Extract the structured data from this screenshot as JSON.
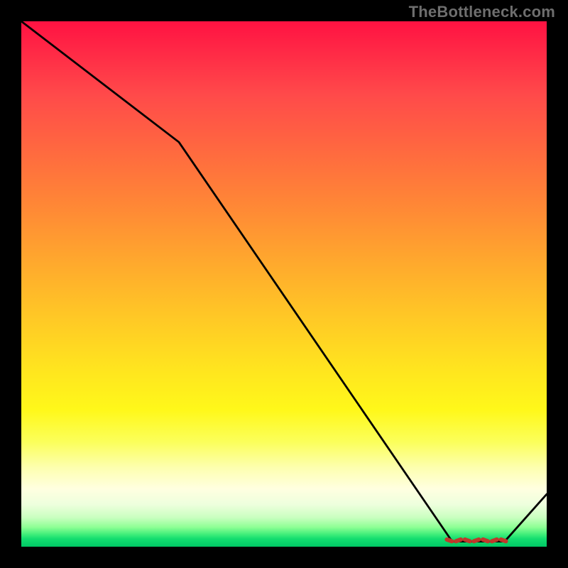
{
  "watermark": "TheBottleneck.com",
  "chart_data": {
    "type": "line",
    "title": "",
    "xlabel": "",
    "ylabel": "",
    "xlim": [
      0,
      100
    ],
    "ylim": [
      0,
      100
    ],
    "grid": false,
    "series": [
      {
        "name": "curve",
        "x": [
          0,
          30,
          82,
          92,
          100
        ],
        "y": [
          100,
          77,
          1,
          1,
          10
        ]
      }
    ],
    "annotations": [
      {
        "name": "bottom-dashes",
        "type": "dashed-segment",
        "x_range": [
          81,
          93
        ],
        "y": 1.2,
        "color": "#c0392b"
      }
    ],
    "background_gradient_stops": [
      {
        "pct": 0,
        "color": "#ff1242"
      },
      {
        "pct": 25,
        "color": "#ff6a3f"
      },
      {
        "pct": 50,
        "color": "#ffbe28"
      },
      {
        "pct": 75,
        "color": "#fff81a"
      },
      {
        "pct": 90,
        "color": "#ffffe0"
      },
      {
        "pct": 100,
        "color": "#00c865"
      }
    ]
  }
}
